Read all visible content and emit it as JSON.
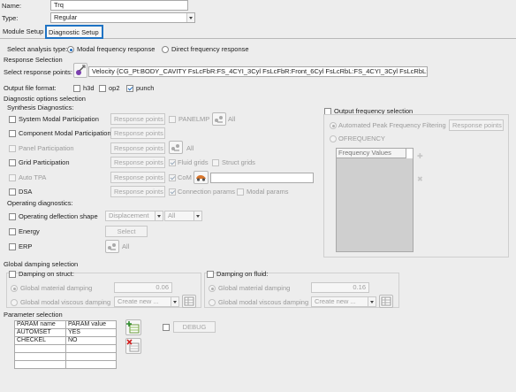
{
  "header": {
    "name_label": "Name:",
    "name_value": "Trq",
    "type_label": "Type:",
    "type_value": "Regular"
  },
  "tabs": [
    {
      "label": "Module Setup"
    },
    {
      "label": "Diagnostic Setup"
    }
  ],
  "analysis": {
    "label": "Select analysis type:",
    "modal": "Modal frequency response",
    "direct": "Direct frequency response"
  },
  "response": {
    "section": "Response Selection",
    "points_label": "Select response points:",
    "points_value": "Velocity {CG_Pt:BODY_CAVITY FsLcFbR:FS_4CYI_3Cyl FsLcFbR:Front_6Cyl FsLcRbL:FS_4CYI_3Cyl FsLcRbL:Front"
  },
  "output_format": {
    "label": "Output file format:",
    "h3d": "h3d",
    "op2": "op2",
    "punch": "punch"
  },
  "diagnostic": {
    "section": "Diagnostic options selection",
    "synthesis": "Synthesis Diagnostics:",
    "rows": [
      {
        "label": "System Modal Participation",
        "button": "Response points",
        "extra": "PANELMP",
        "all": "All"
      },
      {
        "label": "Component Modal Participation",
        "button": "Response points"
      },
      {
        "label": "Panel Participation",
        "button": "Response points",
        "all": "All"
      },
      {
        "label": "Grid Participation",
        "button": "Response points",
        "opt1": "Fluid grids",
        "opt2": "Struct grids"
      },
      {
        "label": "Auto TPA",
        "button": "Response points",
        "opt1": "CoM"
      },
      {
        "label": "DSA",
        "button": "Response points",
        "opt1": "Connection params",
        "opt2": "Modal params"
      }
    ],
    "operating": "Operating diagnostics:",
    "ods_label": "Operating deflection shape",
    "ods_type": "Displacement",
    "ods_all": "All",
    "energy": "Energy",
    "energy_button": "Select",
    "erp": "ERP",
    "erp_all": "All"
  },
  "output_frequency": {
    "label": "Output frequency selection",
    "auto": "Automated Peak Frequency Filtering",
    "auto_button": "Response points",
    "ofreq": "OFREQUENCY",
    "list_header": "Frequency Values"
  },
  "damping": {
    "section": "Global damping selection",
    "struct_label": "Damping on struct:",
    "fluid_label": "Damping on fluid:",
    "material": "Global material damping",
    "struct_material_value": "0.06",
    "fluid_material_value": "0.16",
    "viscous": "Global modal viscous damping",
    "create_new": "Create new ..."
  },
  "parameters": {
    "section": "Parameter selection",
    "columns": [
      "PARAM name",
      "PARAM value"
    ],
    "rows": [
      [
        "AUTOMSET",
        "YES"
      ],
      [
        "CHECKEL",
        "NO"
      ]
    ],
    "debug": "DEBUG"
  }
}
